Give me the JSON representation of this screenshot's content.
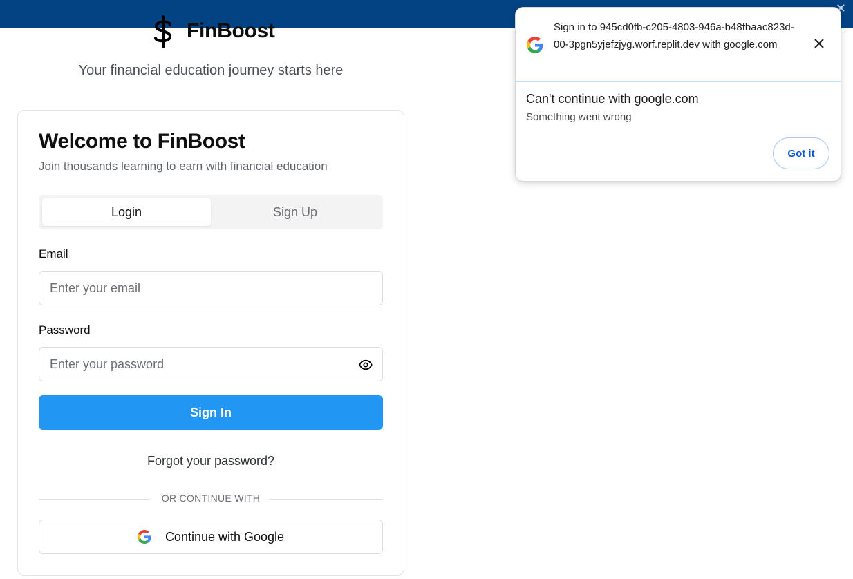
{
  "brand": {
    "name": "FinBoost",
    "icon": "dollar-sign-icon"
  },
  "tagline": "Your financial education journey starts here",
  "card": {
    "title": "Welcome to FinBoost",
    "subtitle": "Join thousands learning to earn with financial education",
    "tabs": [
      {
        "label": "Login",
        "active": true
      },
      {
        "label": "Sign Up",
        "active": false
      }
    ],
    "email": {
      "label": "Email",
      "placeholder": "Enter your email",
      "value": ""
    },
    "password": {
      "label": "Password",
      "placeholder": "Enter your password",
      "value": "",
      "toggle_icon": "eye-icon"
    },
    "sign_in_label": "Sign In",
    "forgot_label": "Forgot your password?",
    "divider_label": "OR CONTINUE WITH",
    "google_label": "Continue with Google"
  },
  "popup": {
    "title": "Sign in to 945cd0fb-c205-4803-946a-b48fbaac823d-00-3pgn5yjefzjyg.worf.replit.dev with google.com",
    "heading": "Can't continue with google.com",
    "message": "Something went wrong",
    "button_label": "Got it"
  },
  "colors": {
    "topbar": "#044383",
    "primary_button": "#2196f3",
    "google_blue": "#4285F4",
    "google_red": "#EA4335",
    "google_yellow": "#FBBC05",
    "google_green": "#34A853",
    "popup_link": "#0b57d0"
  }
}
